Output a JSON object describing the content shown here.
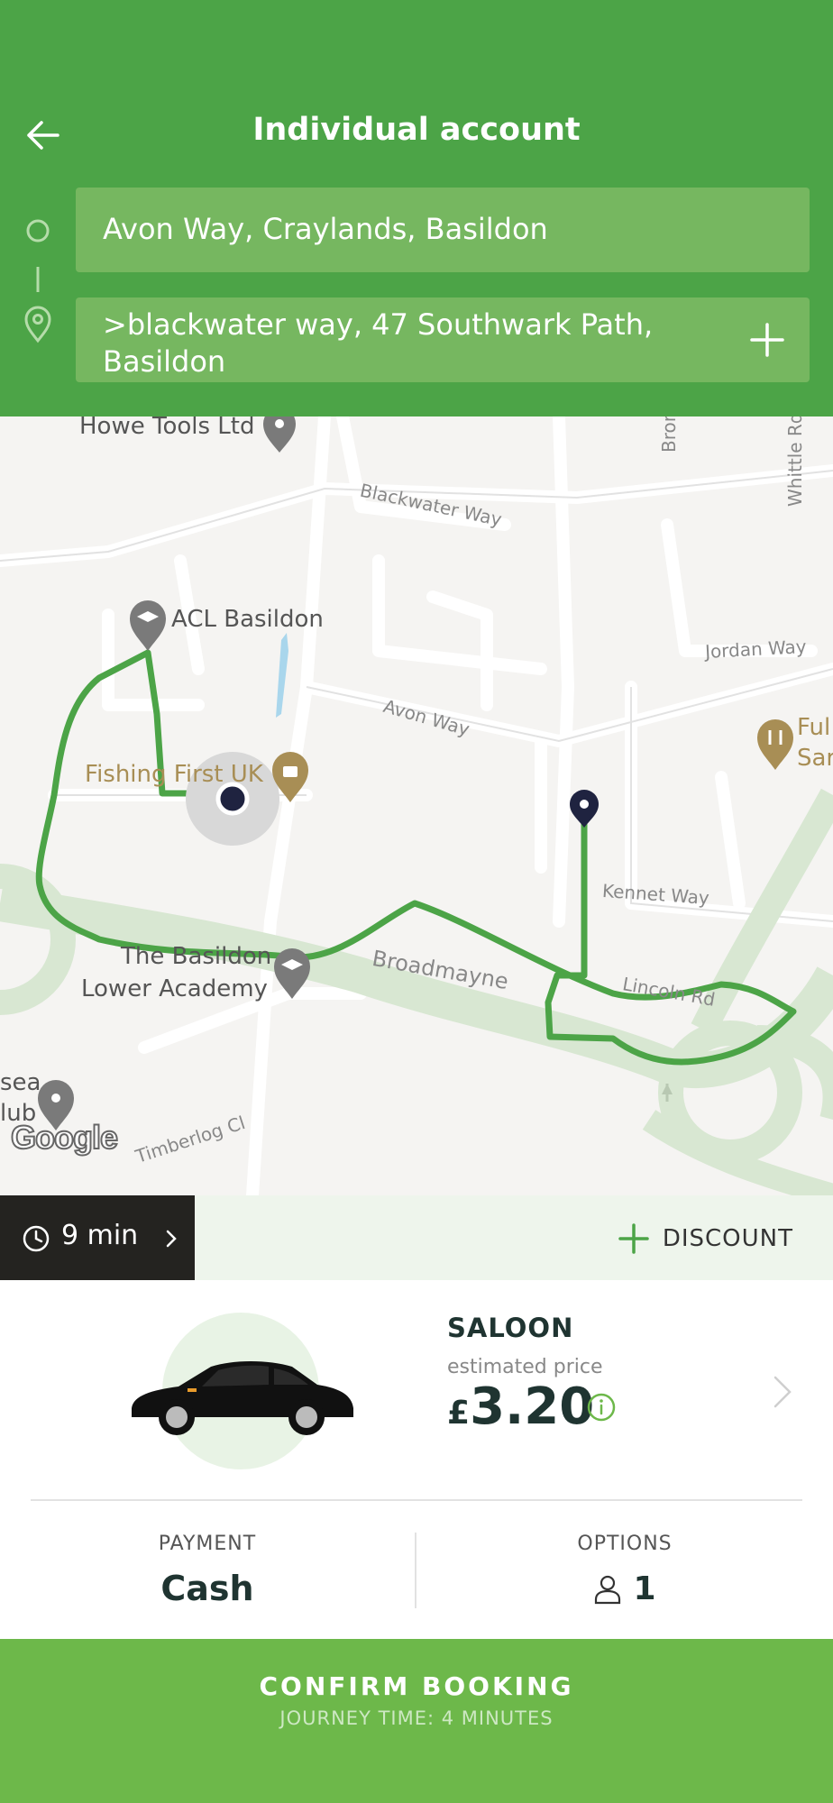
{
  "header": {
    "title": "Individual account",
    "pickup": "Avon Way, Craylands, Basildon",
    "destination": ">blackwater way, 47 Southwark Path, Basildon"
  },
  "map": {
    "places": {
      "howe_tools": "Howe Tools Ltd",
      "acl_basildon": "ACL Basildon",
      "fishing_first": "Fishing First UK",
      "basildon_academy_1": "The Basildon",
      "basildon_academy_2": "Lower Academy",
      "ful_1": "Ful",
      "ful_2": "Sar",
      "sea_1": "sea",
      "sea_2": "lub"
    },
    "streets": {
      "blackwater": "Blackwater Way",
      "bronte": "Bronte D",
      "whittle": "Whittle Rd",
      "jordan": "Jordan Way",
      "avon": "Avon Way",
      "kennet": "Kennet Way",
      "broadmayne": "Broadmayne",
      "lincoln": "Lincoln Rd",
      "timberlog": "Timberlog Cl"
    },
    "attribution": "Google"
  },
  "strip": {
    "time": "9 min",
    "discount_label": "DISCOUNT"
  },
  "vehicle": {
    "name": "SALOON",
    "estimated_label": "estimated price",
    "currency": "£",
    "price": "3.20"
  },
  "payment": {
    "caption": "PAYMENT",
    "value": "Cash"
  },
  "options": {
    "caption": "OPTIONS",
    "passengers": "1"
  },
  "confirm": {
    "label": "CONFIRM BOOKING",
    "journey": "JOURNEY TIME: 4 MINUTES"
  },
  "colors": {
    "header_green": "#4ca447",
    "route_green": "#4ca447",
    "confirm_green": "#6db84a",
    "time_box": "#242320"
  }
}
